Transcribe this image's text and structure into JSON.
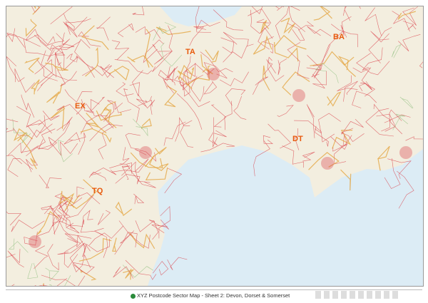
{
  "map": {
    "regions": [
      "TA",
      "BA",
      "EX",
      "DT",
      "TQ"
    ],
    "colors": {
      "land": "#f3eedf",
      "sea": "#dcecf5",
      "roads": "#d9404a",
      "boundaries": "#e3a23a",
      "green": "#8fbf7f"
    }
  },
  "footer": {
    "logo": "globe-logo",
    "title": "XYZ Postcode Sector Map  -  Sheet 2:  Devon, Dorset & Somerset"
  }
}
